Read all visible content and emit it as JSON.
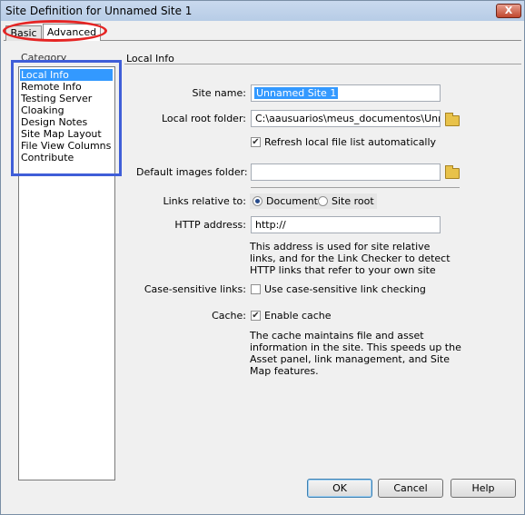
{
  "window": {
    "title": "Site Definition for Unnamed Site 1",
    "close_glyph": "X"
  },
  "tabs": [
    {
      "label": "Basic"
    },
    {
      "label": "Advanced"
    }
  ],
  "category": {
    "label": "Category",
    "items": [
      {
        "label": "Local Info"
      },
      {
        "label": "Remote Info"
      },
      {
        "label": "Testing Server"
      },
      {
        "label": "Cloaking"
      },
      {
        "label": "Design Notes"
      },
      {
        "label": "Site Map Layout"
      },
      {
        "label": "File View Columns"
      },
      {
        "label": "Contribute"
      }
    ]
  },
  "local_info": {
    "section_title": "Local Info",
    "site_name_label": "Site name:",
    "site_name_value": "Unnamed Site 1",
    "local_root_label": "Local root folder:",
    "local_root_value": "C:\\aausuarios\\meus_documentos\\Unname",
    "refresh_label": "Refresh local file list automatically",
    "default_images_label": "Default images folder:",
    "default_images_value": "",
    "links_relative_label": "Links relative to:",
    "document_option": "Document",
    "site_root_option": "Site root",
    "http_label": "HTTP address:",
    "http_value": "http://",
    "http_help": "This address is used for site relative links, and for the Link Checker to detect HTTP links that refer to your own site",
    "case_label": "Case-sensitive links:",
    "case_checkbox_label": "Use case-sensitive link checking",
    "cache_label": "Cache:",
    "cache_checkbox_label": "Enable cache",
    "cache_help": "The cache maintains file and asset information in the site.  This speeds up the Asset panel, link management, and Site Map features."
  },
  "state": {
    "refresh_checked": true,
    "case_checked": false,
    "cache_checked": true,
    "links_relative": "Document"
  },
  "buttons": {
    "ok": "OK",
    "cancel": "Cancel",
    "help": "Help"
  },
  "annotations": {
    "tab_circle_color": "#e52423",
    "category_box_color": "#3f5ed8"
  }
}
